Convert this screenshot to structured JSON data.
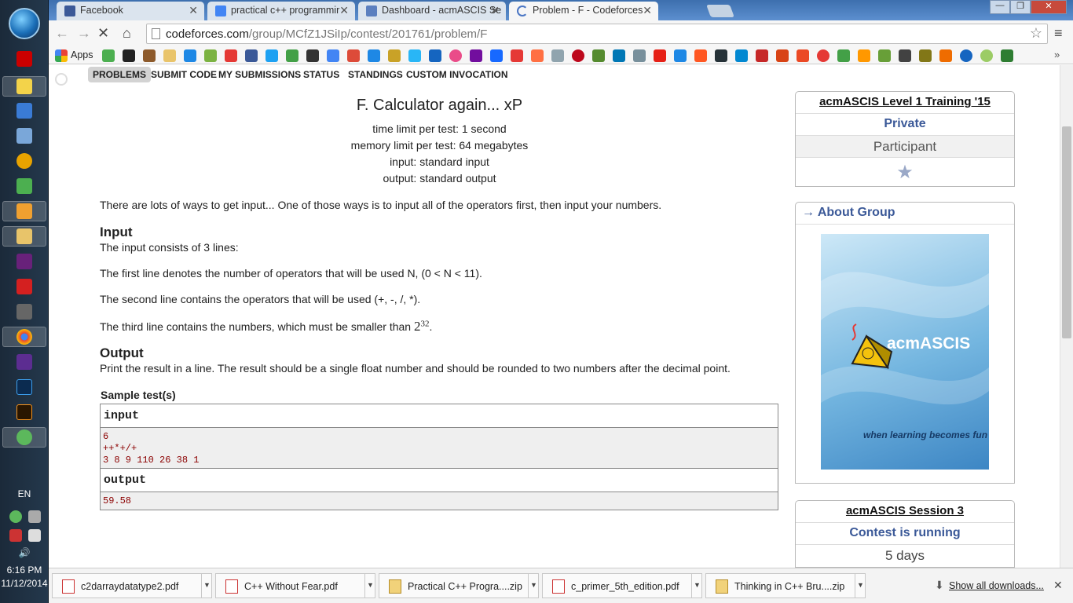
{
  "taskbar": {
    "lang": "EN",
    "time": "6:16 PM",
    "date": "11/12/2014"
  },
  "tabs": [
    {
      "title": "Facebook",
      "color": "#3b5998"
    },
    {
      "title": "practical c++ programmir",
      "color": "#4285f4"
    },
    {
      "title": "Dashboard - acmASCIS Se",
      "color": "#5b7fbf"
    },
    {
      "title": "Problem - F - Codeforces",
      "color": "#4a76c4"
    }
  ],
  "address": {
    "host": "codeforces.com",
    "path": "/group/MCfZ1JSiIp/contest/201761/problem/F"
  },
  "bookmarks": {
    "apps_label": "Apps"
  },
  "menu": [
    "PROBLEMS",
    "SUBMIT CODE",
    "MY SUBMISSIONS",
    "STATUS",
    "STANDINGS",
    "CUSTOM INVOCATION"
  ],
  "problem": {
    "title": "F. Calculator again... xP",
    "time_limit": "time limit per test: 1 second",
    "memory_limit": "memory limit per test: 64 megabytes",
    "input_file": "input: standard input",
    "output_file": "output: standard output",
    "statement": "There are lots of ways to get input... One of those ways is to input all of the operators first, then input your numbers.",
    "input_title": "Input",
    "input_lines": [
      "The input consists of 3 lines:",
      "The first line denotes the number of operators that will be used N, (0 < N < 11).",
      "The second line contains the operators that will be used (+, -, /, *).",
      "The third line contains the numbers, which must be smaller than "
    ],
    "pow_base": "2",
    "pow_exp": "32",
    "pow_dot": ".",
    "output_title": "Output",
    "output_text": "Print the result in a line. The result should be a single float number and should be rounded to two numbers after the decimal point.",
    "sample_title": "Sample test(s)",
    "input_label": "input",
    "sample_input": "6\n++*+/+\n3 8 9 110 26 38 1",
    "output_label": "output",
    "sample_output": "59.58"
  },
  "sidebar": {
    "contest_title": "acmASCIS Level 1 Training '15",
    "privacy": "Private",
    "role": "Participant",
    "about_title": "→ About Group",
    "poster_brand": "acmASCIS",
    "poster_tagline": "when learning becomes fun",
    "session_title": "acmASCIS Session 3",
    "session_status": "Contest is running",
    "session_time": "5 days"
  },
  "downloads": {
    "items": [
      "c2darraydatatype2.pdf",
      "C++ Without Fear.pdf",
      "Practical C++ Progra....zip",
      "c_primer_5th_edition.pdf",
      "Thinking in C++ Bru....zip"
    ],
    "show_all": "Show all downloads..."
  }
}
